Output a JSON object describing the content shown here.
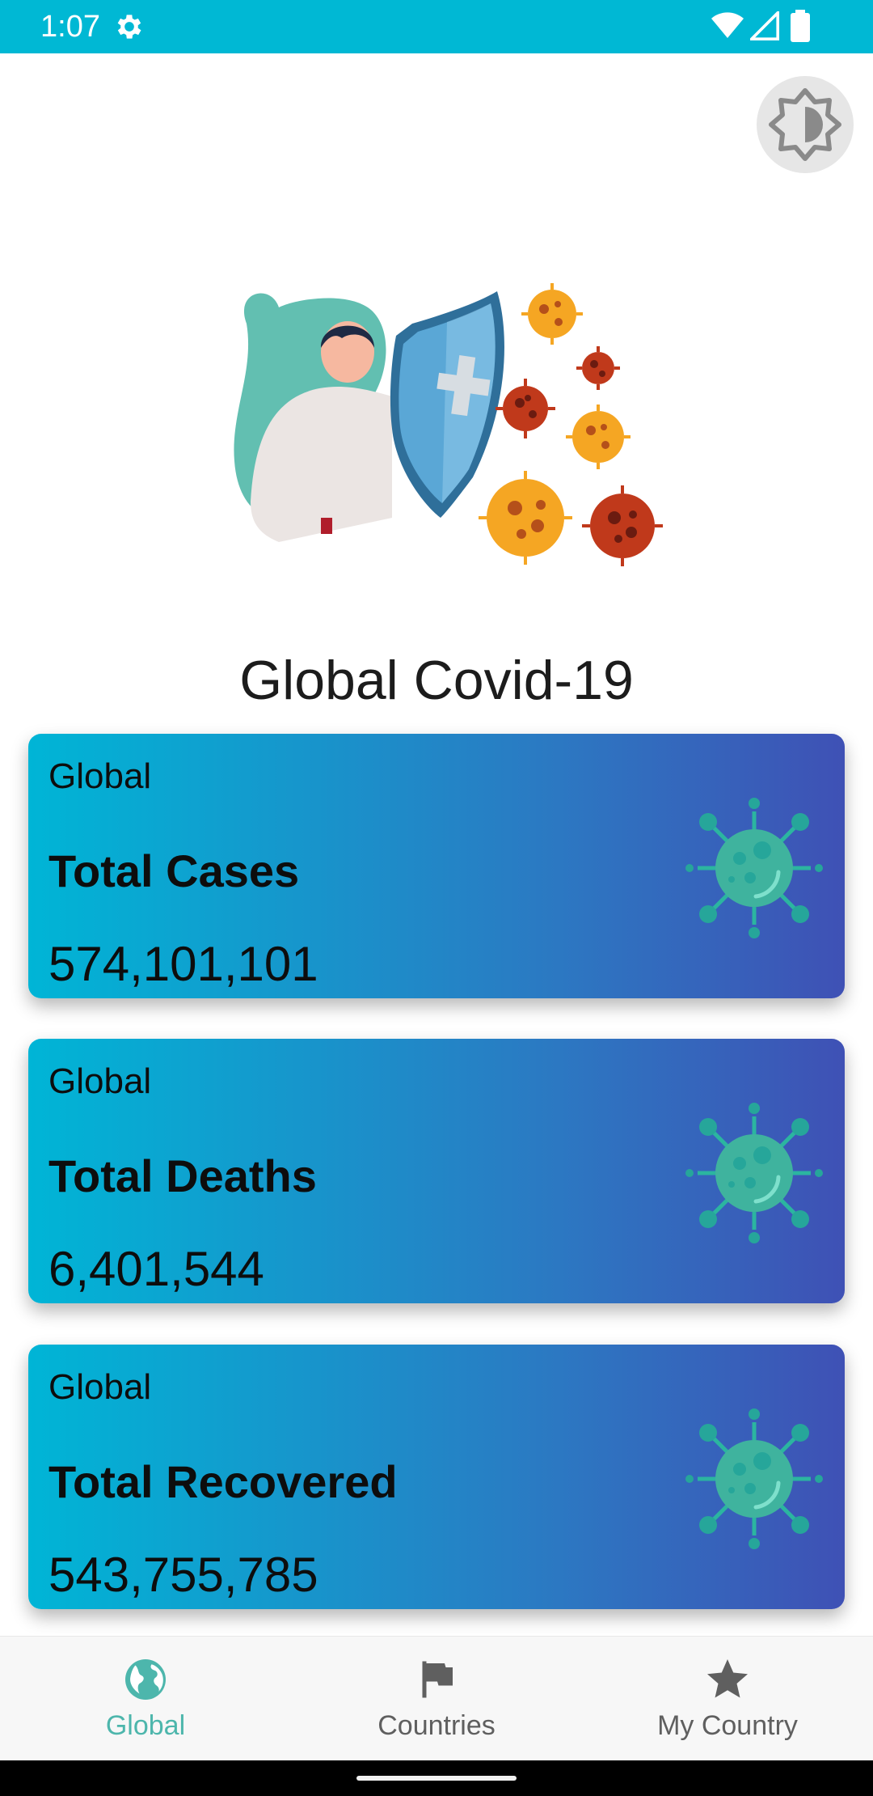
{
  "status_bar": {
    "time": "1:07",
    "icons": [
      "settings-icon",
      "wifi-icon",
      "signal-icon",
      "battery-icon"
    ],
    "background": "#00b8d4"
  },
  "header": {
    "theme_toggle_icon": "brightness-icon",
    "hero_image": "person-with-shield-and-virus-illustration"
  },
  "page_title": "Global Covid-19",
  "cards": [
    {
      "region": "Global",
      "label": "Total Cases",
      "value": "574,101,101",
      "icon": "virus-icon"
    },
    {
      "region": "Global",
      "label": "Total Deaths",
      "value": "6,401,544",
      "icon": "virus-icon"
    },
    {
      "region": "Global",
      "label": "Total Recovered",
      "value": "543,755,785",
      "icon": "virus-icon"
    }
  ],
  "bottom_nav": {
    "items": [
      {
        "label": "Global",
        "icon": "globe-icon",
        "active": true
      },
      {
        "label": "Countries",
        "icon": "flag-icon",
        "active": false
      },
      {
        "label": "My Country",
        "icon": "star-icon",
        "active": false
      }
    ],
    "active_color": "#4db6ac",
    "inactive_color": "#5f5f5f"
  },
  "colors": {
    "card_gradient_start": "#00b5d6",
    "card_gradient_end": "#3f51b5",
    "virus_green": "#26a69a"
  }
}
